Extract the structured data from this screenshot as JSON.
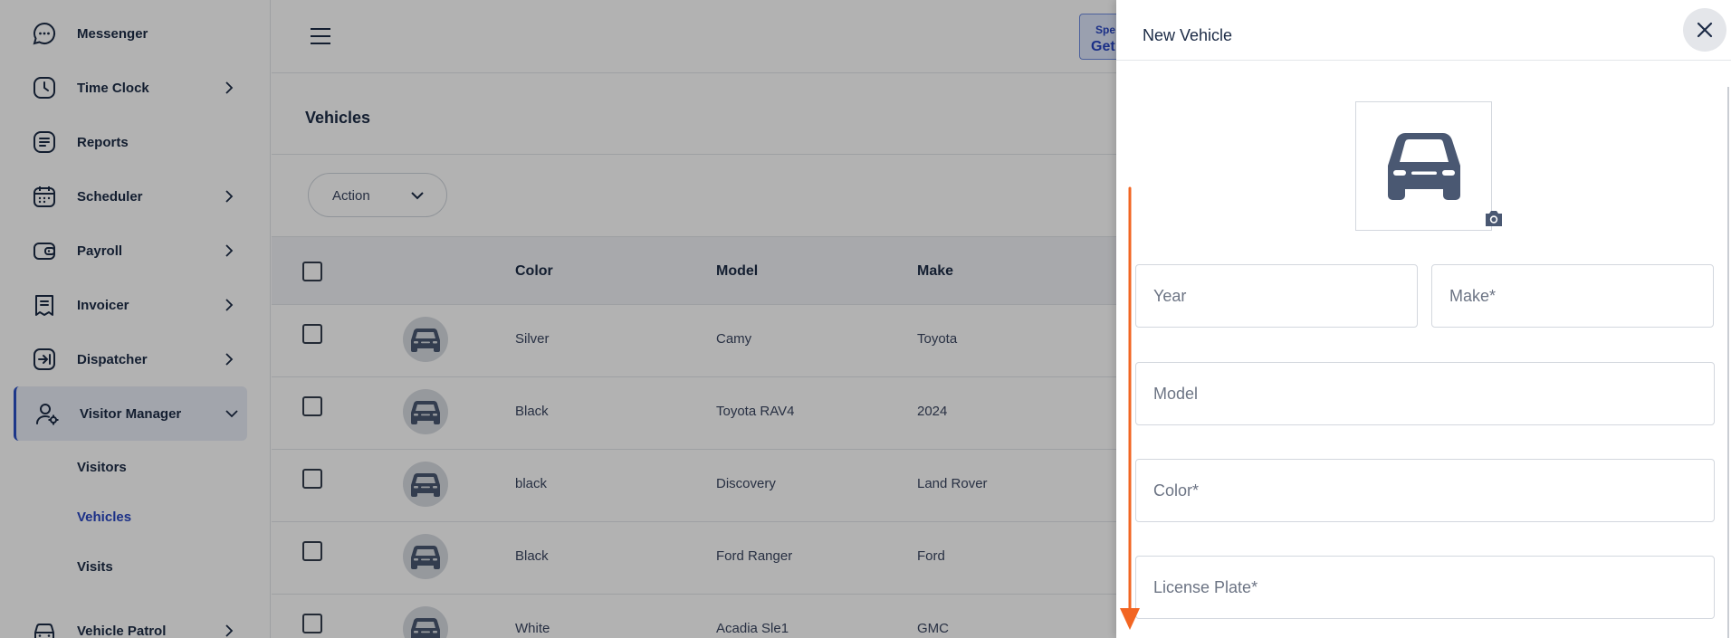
{
  "sidebar": {
    "items": [
      {
        "label": "Messenger",
        "icon": "chat-bubble-icon",
        "has_chevron": false
      },
      {
        "label": "Time Clock",
        "icon": "clock-icon",
        "has_chevron": true
      },
      {
        "label": "Reports",
        "icon": "report-icon",
        "has_chevron": false
      },
      {
        "label": "Scheduler",
        "icon": "calendar-icon",
        "has_chevron": true
      },
      {
        "label": "Payroll",
        "icon": "wallet-icon",
        "has_chevron": true
      },
      {
        "label": "Invoicer",
        "icon": "invoice-icon",
        "has_chevron": true
      },
      {
        "label": "Dispatcher",
        "icon": "dispatch-icon",
        "has_chevron": true
      },
      {
        "label": "Visitor Manager",
        "icon": "user-gear-icon",
        "has_chevron": true,
        "expanded": true,
        "active": true
      },
      {
        "label": "Vehicle Patrol",
        "icon": "car-icon",
        "has_chevron": true
      }
    ],
    "sub_items": [
      {
        "label": "Visitors",
        "active": false
      },
      {
        "label": "Vehicles",
        "active": true
      },
      {
        "label": "Visits",
        "active": false
      }
    ]
  },
  "header": {
    "promo_line1": "Spe",
    "promo_line2": "Get"
  },
  "page": {
    "title": "Vehicles",
    "action_label": "Action"
  },
  "table": {
    "columns": [
      "Color",
      "Model",
      "Make"
    ],
    "rows": [
      {
        "color": "Silver",
        "model": "Camy",
        "make": "Toyota"
      },
      {
        "color": "Black",
        "model": "Toyota RAV4",
        "make": "2024"
      },
      {
        "color": "black",
        "model": "Discovery",
        "make": "Land Rover"
      },
      {
        "color": "Black",
        "model": "Ford Ranger",
        "make": "Ford"
      },
      {
        "color": "White",
        "model": "Acadia Sle1",
        "make": "GMC"
      }
    ]
  },
  "panel": {
    "title": "New Vehicle",
    "fields": {
      "year": "Year",
      "make": "Make*",
      "model": "Model",
      "color": "Color*",
      "license_plate": "License Plate*"
    }
  },
  "colors": {
    "accent": "#2845c2",
    "arrow": "#f26522",
    "icon": "#4a5872"
  }
}
